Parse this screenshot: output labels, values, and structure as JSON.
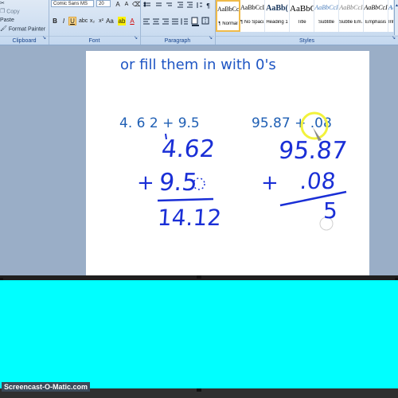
{
  "ribbon": {
    "clipboard": {
      "label": "Clipboard",
      "paste_label": "Paste",
      "copy_label": "Copy",
      "format_painter_label": "Format Painter"
    },
    "font": {
      "label": "Font",
      "font_name": "Comic Sans MS",
      "font_size": "20"
    },
    "paragraph": {
      "label": "Paragraph"
    },
    "styles": {
      "label": "Styles",
      "items": [
        {
          "sample": "AaBbCcI",
          "name": "¶ Normal"
        },
        {
          "sample": "AaBbCcI",
          "name": "¶ No Spaci..."
        },
        {
          "sample": "AaBb(",
          "name": "Heading 1"
        },
        {
          "sample": "AaBbC",
          "name": "Title"
        },
        {
          "sample": "AaBbCcI",
          "name": "Subtitle"
        },
        {
          "sample": "AaBbCcI",
          "name": "Subtle Em..."
        },
        {
          "sample": "AaBbCcI",
          "name": "Emphasis"
        },
        {
          "sample": "AaBbCcI",
          "name": "Intense E..."
        }
      ]
    }
  },
  "document": {
    "heading": "or fill them in with 0's",
    "problem1": "4. 6 2 + 9.5",
    "problem2": "95.87 + .08",
    "handwriting": {
      "p1_line1": "4.62",
      "p1_line2_sign": "+",
      "p1_line2": "9.5",
      "p1_result": "14.12",
      "p2_line1": "95.87",
      "p2_line2_sign": "+",
      "p2_line2": ".08",
      "p2_result": "5"
    }
  },
  "watermark": "Screencast-O-Matic.com",
  "colors": {
    "typed_text": "#1f5fb4",
    "handwriting": "#1a2fd6",
    "highlight_circle": "#f2f23c",
    "lower_panel": "#00ffff"
  }
}
